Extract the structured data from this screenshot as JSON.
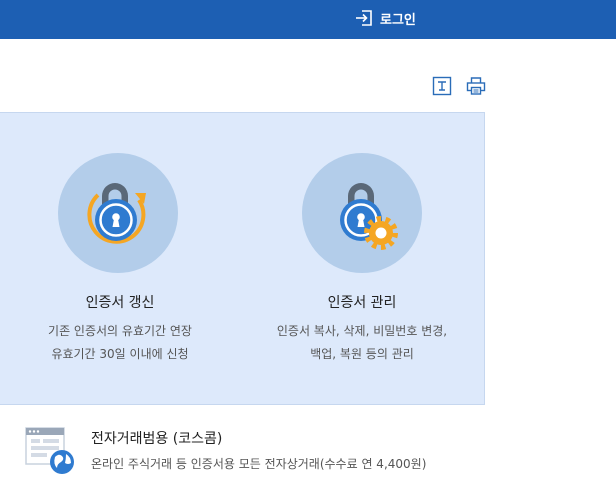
{
  "header": {
    "login_label": "로그인"
  },
  "toolbar": {
    "text_size_icon": "text-size-icon",
    "print_icon": "print-icon"
  },
  "cards": [
    {
      "title": "인증서 갱신",
      "desc_lines": [
        "기존 인증서의 유효기간 연장",
        "유효기간 30일 이내에 신청"
      ],
      "icon": "lock-renew-icon"
    },
    {
      "title": "인증서 관리",
      "desc_lines": [
        "인증서 복사, 삭제, 비밀번호 변경,",
        "백업, 복원 등의 관리"
      ],
      "icon": "lock-gear-icon"
    }
  ],
  "service": {
    "title": "전자거래범용 (코스콤)",
    "desc": "온라인 주식거래 등 인증서용 모든 전자상거래(수수료 연 4,400원)",
    "icon": "browser-globe-icon"
  },
  "colors": {
    "header_bg": "#1d5fb3",
    "panel_bg": "#dde9fb",
    "icon_circle": "#b3cdea",
    "lock_blue": "#2f7bd0",
    "accent_orange": "#f5a623"
  }
}
